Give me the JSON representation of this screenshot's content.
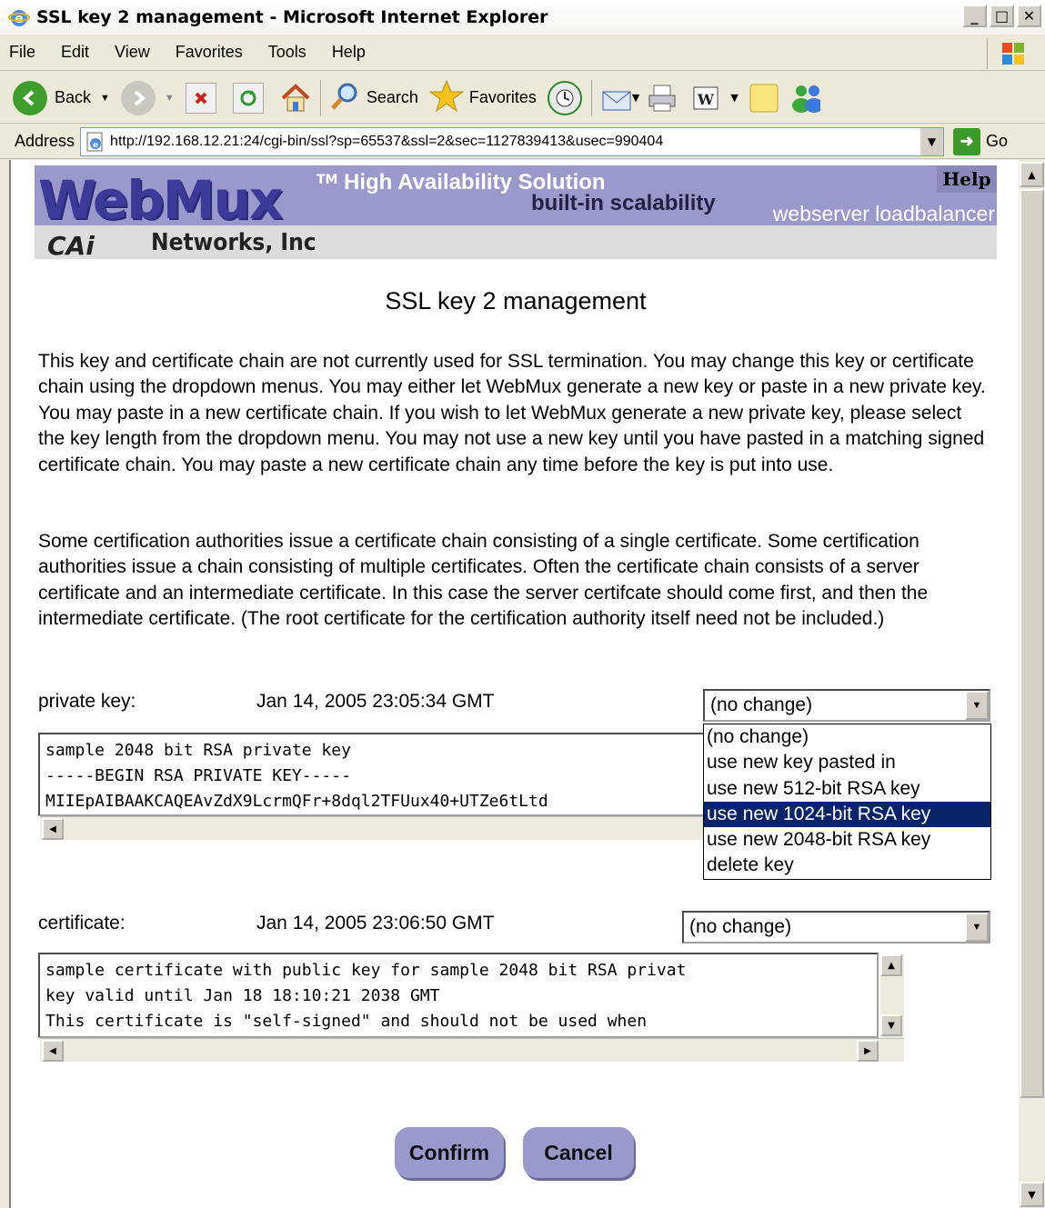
{
  "window": {
    "title": "SSL key 2 management - Microsoft Internet Explorer",
    "min": "_",
    "max": "□",
    "close": "✕"
  },
  "menu": [
    "File",
    "Edit",
    "View",
    "Favorites",
    "Tools",
    "Help"
  ],
  "toolbar": {
    "back": "Back",
    "search": "Search",
    "favorites": "Favorites"
  },
  "address": {
    "label": "Address",
    "url": "http://192.168.12.21:24/cgi-bin/ssl?sp=65537&ssl=2&sec=1127839413&usec=990404",
    "go": "Go"
  },
  "banner": {
    "logo": "WebMux",
    "tm": "TM",
    "tagline1": "High Availability Solution",
    "tagline2": "built-in scalability",
    "tagline3": "webserver loadbalancer",
    "help": "Help",
    "company_mark": "CAi",
    "company": "Networks, Inc"
  },
  "page": {
    "title": "SSL key 2 management",
    "para1": "This key and certificate chain are not currently used for SSL termination. You may change this key or certificate chain using the dropdown menus. You may either let WebMux generate a new key or paste in a new private key. You may paste in a new certificate chain. If you wish to let WebMux generate a new private key, please select the key length from the dropdown menu. You may not use a new key until you have pasted in a matching signed certificate chain. You may paste a new certificate chain any time before the key is put into use.",
    "para2": "Some certification authorities issue a certificate chain consisting of a single certificate. Some certification authorities issue a chain consisting of multiple certificates. Often the certificate chain consists of a server certificate and an intermediate certificate. In this case the server certifcate should come first, and then the intermediate certificate. (The root certificate for the certification authority itself need not be included.)"
  },
  "private_key": {
    "label": "private key:",
    "date": "Jan 14, 2005 23:05:34 GMT",
    "select_value": "(no change)",
    "options": [
      "(no change)",
      "use new key pasted in",
      "use new 512-bit RSA key",
      "use new 1024-bit RSA key",
      "use new 2048-bit RSA key",
      "delete key"
    ],
    "highlighted_option": "use new 1024-bit RSA key",
    "text": "sample 2048 bit RSA private key\n-----BEGIN RSA PRIVATE KEY-----\nMIIEpAIBAAKCAQEAvZdX9LcrmQFr+8dql2TFUux40+UTZe6tLtd"
  },
  "certificate": {
    "label": "certificate:",
    "date": "Jan 14, 2005 23:06:50 GMT",
    "select_value": "(no change)",
    "text": "sample certificate with public key for sample 2048 bit RSA privat\nkey valid until Jan 18 18:10:21 2038 GMT\nThis certificate is \"self-signed\" and should not be used when"
  },
  "buttons": {
    "confirm": "Confirm",
    "cancel": "Cancel"
  }
}
